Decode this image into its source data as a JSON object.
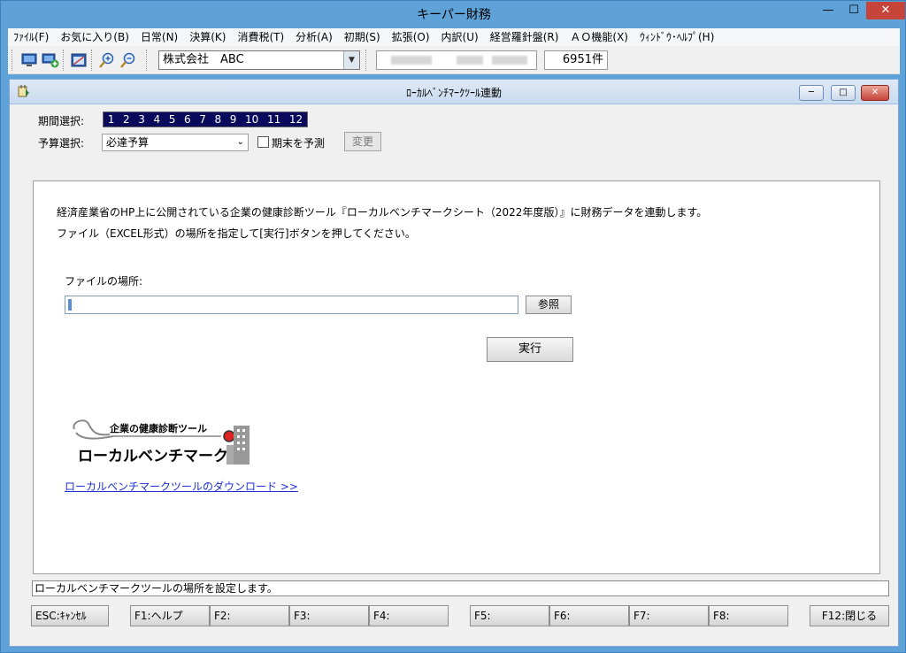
{
  "window": {
    "title": "キーパー財務"
  },
  "menu": [
    "ﾌｧｲﾙ(F)",
    "お気に入り(B)",
    "日常(N)",
    "決算(K)",
    "消費税(T)",
    "分析(A)",
    "初期(S)",
    "拡張(O)",
    "内訳(U)",
    "経営羅針盤(R)",
    "ＡＯ機能(X)",
    "ｳｨﾝﾄﾞｳ･ﾍﾙﾌﾟ(H)"
  ],
  "toolbar": {
    "icons": [
      "monitor-icon",
      "monitor-add-icon",
      "window-icon",
      "zoom-in-icon",
      "zoom-out-icon"
    ],
    "company": "株式会社　ABC",
    "record_count": "6951件"
  },
  "dialog": {
    "title": "ﾛｰｶﾙﾍﾞﾝﾁﾏｰｸﾂｰﾙ連動",
    "period_label": "期間選択:",
    "periods": [
      "1",
      "2",
      "3",
      "4",
      "5",
      "6",
      "7",
      "8",
      "9",
      "10",
      "11",
      "12"
    ],
    "budget_label": "予算選択:",
    "budget_value": "必達予算",
    "forecast_label": "期末を予測",
    "forecast_checked": false,
    "change_button": "変更"
  },
  "content": {
    "description_1": "経済産業省のHP上に公開されている企業の健康診断ツール『ローカルベンチマークシート（2022年度版）』に財務データを連動します。",
    "description_2": "ファイル（EXCEL形式）の場所を指定して[実行]ボタンを押してください。",
    "file_label": "ファイルの場所:",
    "file_value": "",
    "browse_button": "参照",
    "run_button": "実行",
    "logo_top": "企業の健康診断ツール",
    "logo_main": "ローカルベンチマーク",
    "download_link": "ローカルベンチマークツールのダウンロード >>"
  },
  "status": "ローカルベンチマークツールの場所を設定します。",
  "fkeys": [
    "ESC:ｷｬﾝｾﾙ",
    "F1:ヘルプ",
    "F2:",
    "F3:",
    "F4:",
    "F5:",
    "F6:",
    "F7:",
    "F8:",
    "F12:閉じる"
  ],
  "colors": {
    "title_bg": "#5fa2d8",
    "period_bg": "#0a0a5c",
    "link": "#1a2fd6",
    "close_red": "#c7443b"
  }
}
